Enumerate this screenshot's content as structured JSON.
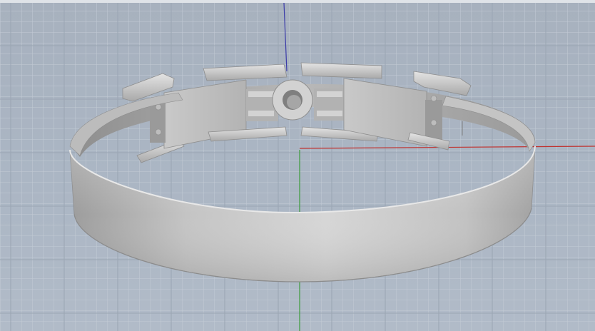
{
  "viewport": {
    "view": "perspective",
    "display_mode": "shaded",
    "grid_visible": true,
    "axes": {
      "x_color": "#c0322f",
      "y_color": "#3c9b3c",
      "z_color": "#3a3aa8"
    }
  },
  "model": {
    "name_icon": "ring-band-model",
    "surface_color": "#c8c8c8"
  }
}
